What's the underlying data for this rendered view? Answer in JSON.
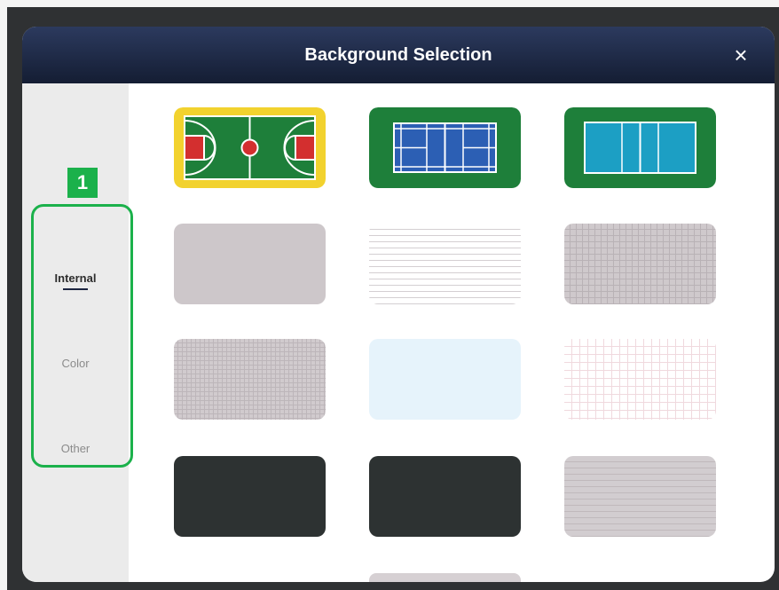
{
  "dialog": {
    "title": "Background Selection",
    "close_label": "×"
  },
  "sidebar": {
    "tabs": [
      {
        "label": "Internal",
        "active": true
      },
      {
        "label": "Color",
        "active": false
      },
      {
        "label": "Other",
        "active": false
      }
    ]
  },
  "backgrounds": [
    {
      "name": "basketball-court"
    },
    {
      "name": "badminton-court"
    },
    {
      "name": "volleyball-court"
    },
    {
      "name": "gray-plain"
    },
    {
      "name": "ruled-lines"
    },
    {
      "name": "gray-grid"
    },
    {
      "name": "gray-fine-grid"
    },
    {
      "name": "light-blue"
    },
    {
      "name": "pink-grid"
    },
    {
      "name": "dark-board"
    },
    {
      "name": "dark-board"
    },
    {
      "name": "gray-ruled"
    }
  ],
  "annotation": {
    "number": "1",
    "color": "#1bb14b"
  },
  "colors": {
    "titlebar": "#1c2742",
    "accent": "#1bb14b",
    "court_green": "#1e7f3a",
    "court_yellow": "#f2d22e"
  }
}
